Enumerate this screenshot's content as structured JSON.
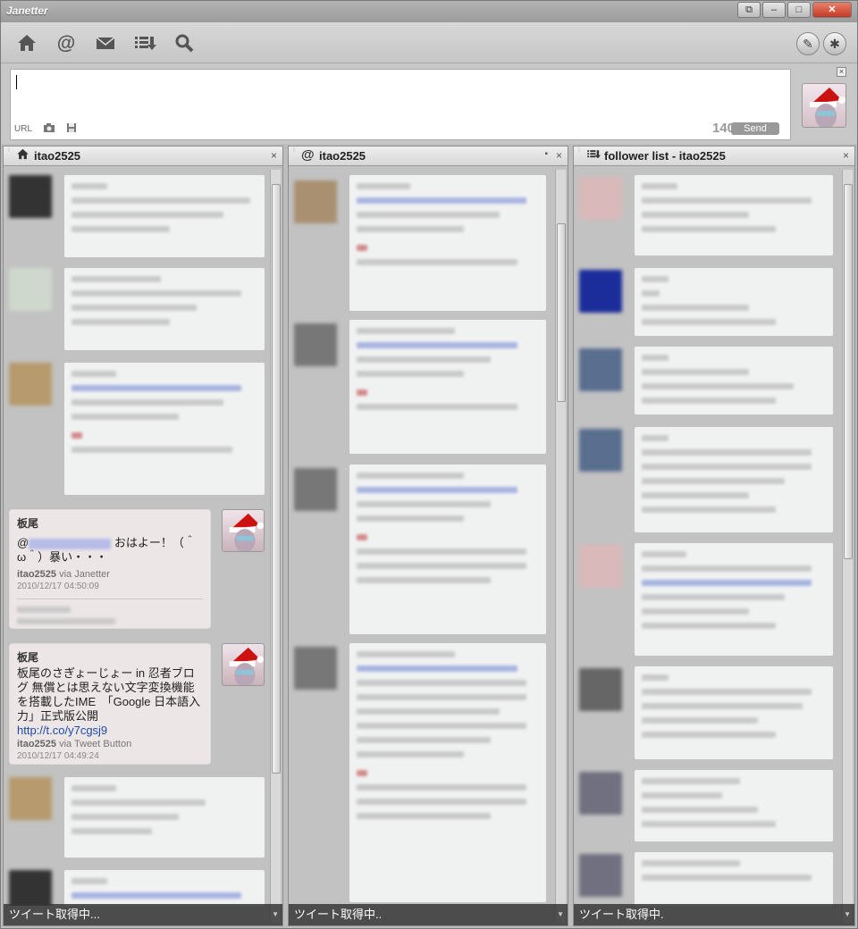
{
  "app": {
    "title": "Janetter"
  },
  "window_controls": {
    "restore": "⧉",
    "minimize": "–",
    "maximize": "□",
    "close": "✕"
  },
  "toolbar": {
    "icons": [
      "home-icon",
      "mention-icon",
      "mail-icon",
      "list-icon",
      "search-icon"
    ],
    "right_icons": [
      "pen-icon",
      "gear-icon"
    ]
  },
  "composer": {
    "tools": [
      "URL",
      "camera-icon",
      "save-icon"
    ],
    "char_count": "140",
    "send_label": "Send",
    "close": "×"
  },
  "columns": [
    {
      "title": "itao2525",
      "icon": "home-icon",
      "close": "×",
      "status": "ツイート取得中..."
    },
    {
      "title": "itao2525",
      "icon": "mention-icon",
      "close": "×",
      "status": "ツイート取得中.."
    },
    {
      "title": "follower list - itao2525",
      "icon": "list-icon",
      "close": "×",
      "status": "ツイート取得中."
    }
  ],
  "tweets": [
    {
      "name": "板尾",
      "text_after_mention": "おはよー！（＾ω＾）暴い・・・",
      "prefix": "@",
      "user": "itao2525",
      "via": "via Janetter",
      "time": "2010/12/17  04:50:09"
    },
    {
      "name": "板尾",
      "text": "板尾のさぎょーじょー in 忍者ブログ 無償とは思えない文字変換機能を搭載したIME　「Google 日本語入力」正式版公開",
      "link": "http://t.co/y7cgsj9",
      "user": "itao2525",
      "via": "via Tweet Button",
      "time": "2010/12/17  04:49:24"
    }
  ],
  "colors": {
    "accent_red": "#c43a22",
    "link_blue": "#1f4aa8",
    "card_bg": "#f0f2f2"
  }
}
